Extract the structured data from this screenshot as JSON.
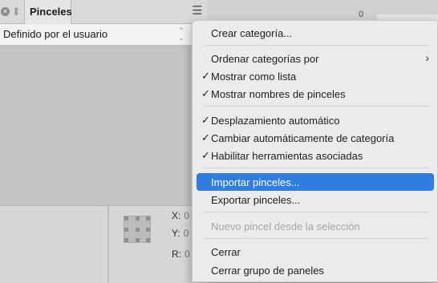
{
  "panel": {
    "tab_title": "Pinceles",
    "category_dropdown": "Definido por el usuario",
    "right_value": "0",
    "coords": [
      {
        "label": "X:",
        "value": "0"
      },
      {
        "label": "Y:",
        "value": "0"
      },
      {
        "label": "R:",
        "value": "0"
      }
    ]
  },
  "menu": {
    "items": [
      {
        "label": "Crear categoría...",
        "checked": false
      },
      {
        "label": "Ordenar categorías por",
        "checked": false,
        "submenu": true
      },
      {
        "label": "Mostrar como lista",
        "checked": true
      },
      {
        "label": "Mostrar nombres de pinceles",
        "checked": true
      },
      {
        "label": "Desplazamiento automático",
        "checked": true
      },
      {
        "label": "Cambiar automáticamente de categoría",
        "checked": true
      },
      {
        "label": "Habilitar herramientas asociadas",
        "checked": true
      },
      {
        "label": "Importar pinceles...",
        "checked": false,
        "highlighted": true
      },
      {
        "label": "Exportar pinceles...",
        "checked": false
      },
      {
        "label": "Nuevo pincel desde la selección",
        "checked": false,
        "disabled": true
      },
      {
        "label": "Cerrar",
        "checked": false
      },
      {
        "label": "Cerrar grupo de paneles",
        "checked": false
      }
    ],
    "check_glyph": "✓",
    "submenu_glyph": "›"
  },
  "colors": {
    "highlight": "#2f7de0",
    "menu_bg": "#ebebeb",
    "panel_bg": "#c4c4c4"
  }
}
